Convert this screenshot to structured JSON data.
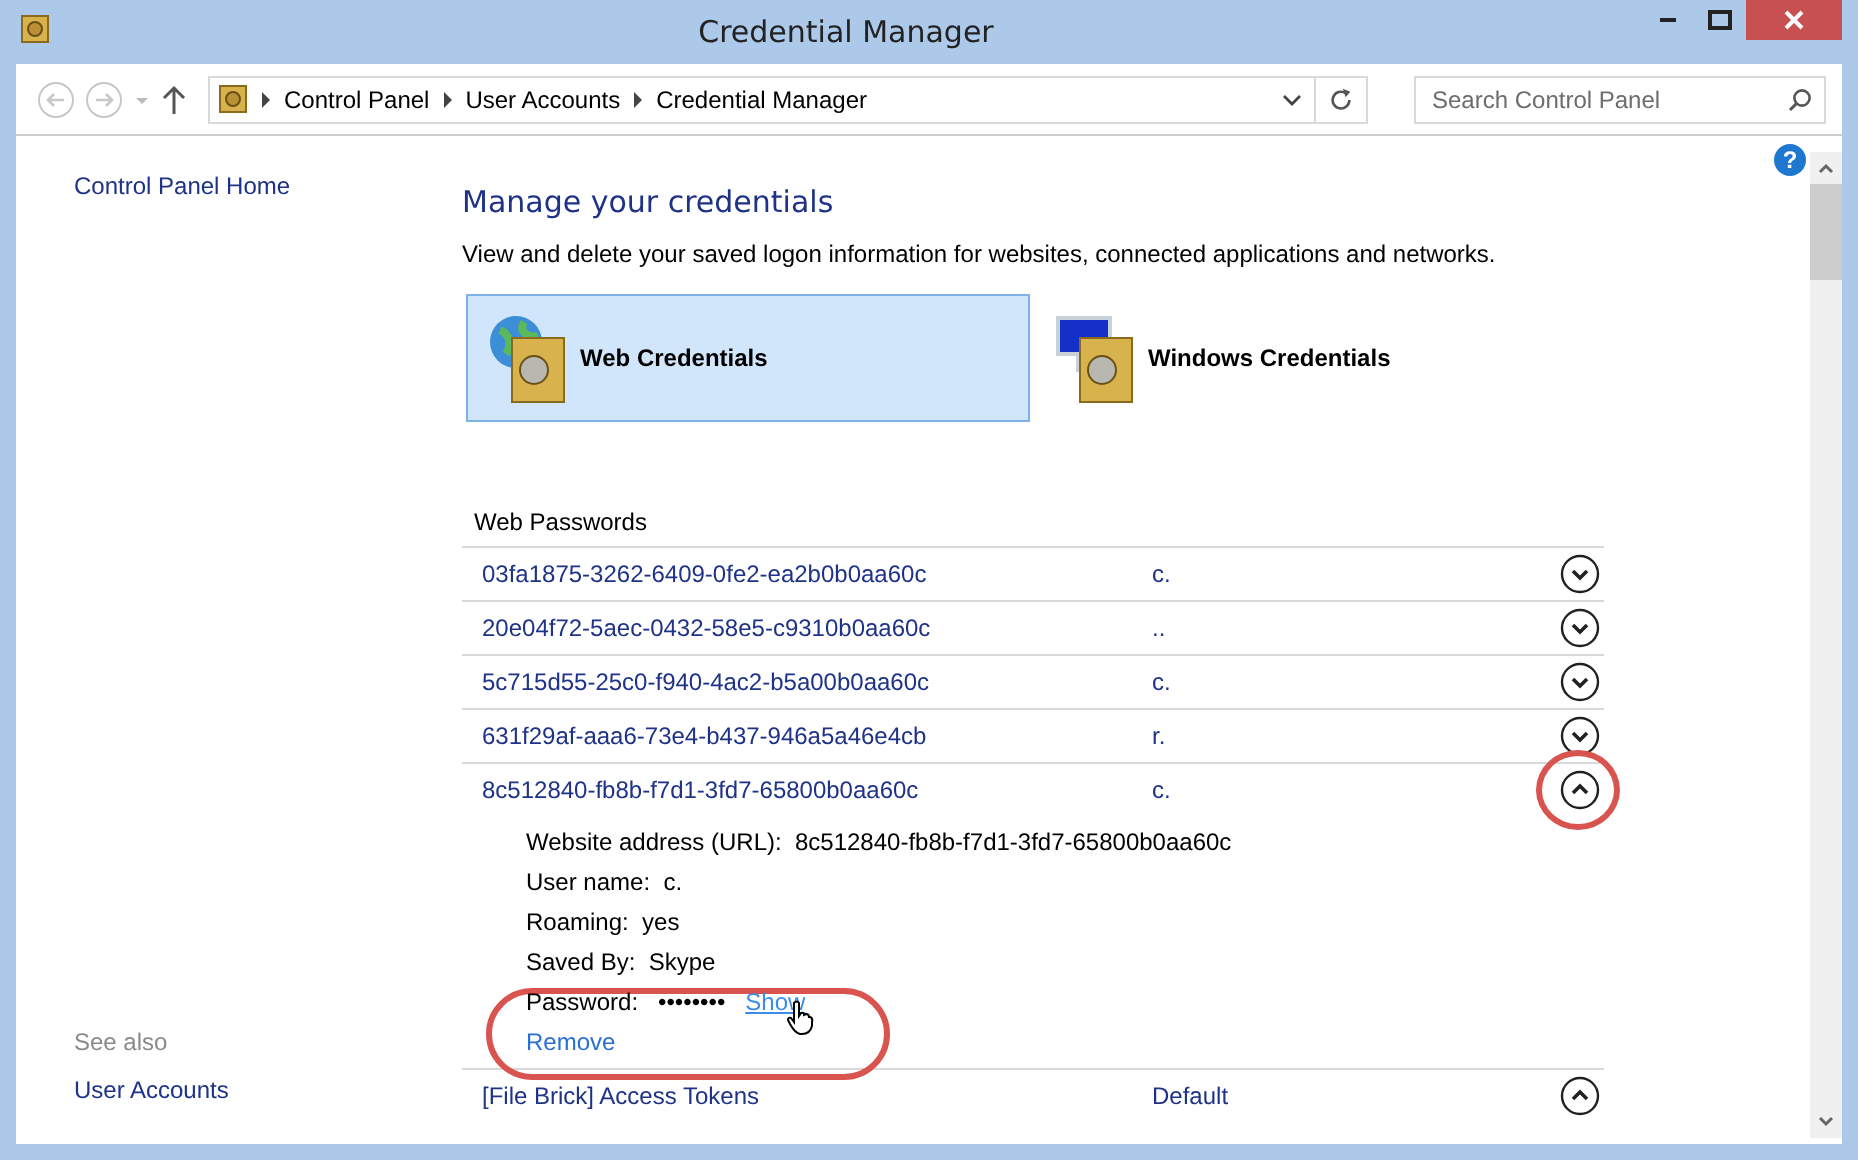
{
  "window": {
    "title": "Credential Manager",
    "help_button": "?"
  },
  "navigation": {
    "breadcrumbs": [
      "Control Panel",
      "User Accounts",
      "Credential Manager"
    ],
    "search": {
      "placeholder": "Search Control Panel"
    }
  },
  "sidebar": {
    "home_link": "Control Panel Home",
    "see_also_heading": "See also",
    "see_also_links": [
      "User Accounts"
    ]
  },
  "main": {
    "heading": "Manage your credentials",
    "description": "View and delete your saved logon information for websites, connected applications and networks.",
    "credential_types": [
      {
        "label": "Web Credentials",
        "kind": "web",
        "selected": true
      },
      {
        "label": "Windows Credentials",
        "kind": "windows",
        "selected": false
      }
    ],
    "section_title": "Web Passwords",
    "entries": [
      {
        "name": "03fa1875-3262-6409-0fe2-ea2b0b0aa60c",
        "user": "c.",
        "expanded": false,
        "toggle_circled": false
      },
      {
        "name": "20e04f72-5aec-0432-58e5-c9310b0aa60c",
        "user": "..",
        "expanded": false,
        "toggle_circled": false
      },
      {
        "name": "5c715d55-25c0-f940-4ac2-b5a00b0aa60c",
        "user": "c.",
        "expanded": false,
        "toggle_circled": false
      },
      {
        "name": "631f29af-aaa6-73e4-b437-946a5a46e4cb",
        "user": "r.",
        "expanded": false,
        "toggle_circled": false
      },
      {
        "name": "8c512840-fb8b-f7d1-3fd7-65800b0aa60c",
        "user": "c.",
        "expanded": true,
        "toggle_circled": true,
        "details": [
          {
            "label": "Website address (URL):",
            "value": "8c512840-fb8b-f7d1-3fd7-65800b0aa60c"
          },
          {
            "label": "User name:",
            "value": "c."
          },
          {
            "label": "Roaming:",
            "value": "yes"
          },
          {
            "label": "Saved By:",
            "value": "Skype"
          }
        ],
        "password": {
          "label": "Password:",
          "mask": "••••••••",
          "show_link": "Show",
          "show_hovered": true
        },
        "remove_link": "Remove",
        "actions_circled": true
      },
      {
        "name": "[File Brick] Access Tokens",
        "user": "Default",
        "expanded": true,
        "toggle_circled": false
      }
    ]
  }
}
